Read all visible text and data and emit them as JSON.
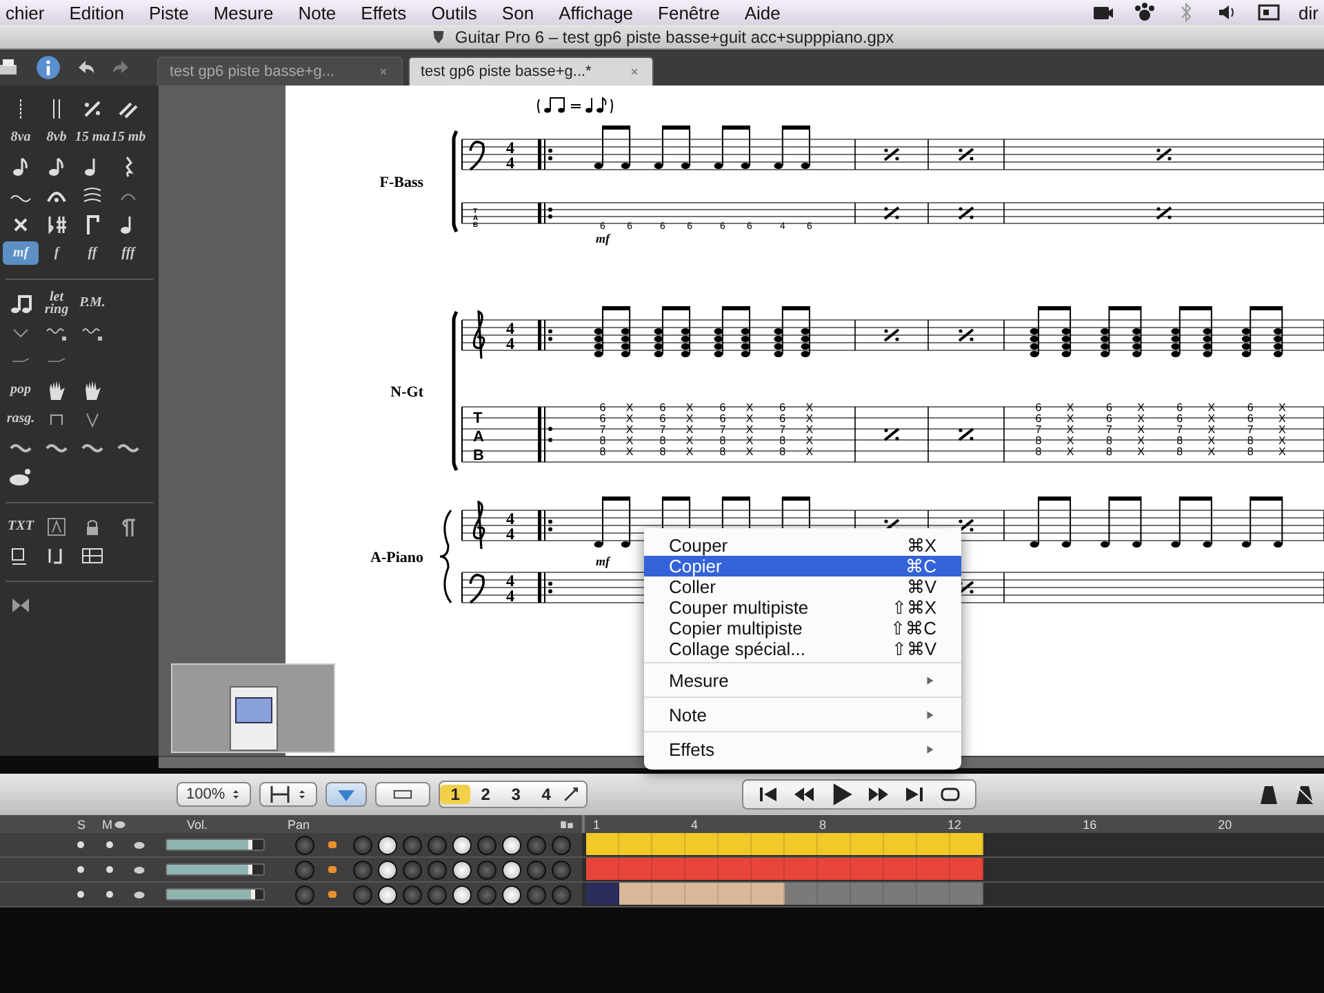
{
  "menu_bar": {
    "items": [
      "chier",
      "Edition",
      "Piste",
      "Mesure",
      "Note",
      "Effets",
      "Outils",
      "Son",
      "Affichage",
      "Fenêtre",
      "Aide"
    ],
    "user": "dir"
  },
  "window": {
    "title": "Guitar Pro 6 – test gp6 piste basse+guit acc+supppiano.gpx"
  },
  "tabs": [
    {
      "label": "test gp6 piste basse+g...",
      "selected": false
    },
    {
      "label": "test gp6 piste basse+g...*",
      "selected": true
    }
  ],
  "palette": {
    "items": [
      {
        "text": "8va",
        "selected": false
      },
      {
        "text": "8vb",
        "selected": false
      },
      {
        "text": "15 ma",
        "selected": false
      },
      {
        "text": "15 mb",
        "selected": false
      },
      {
        "text": "mf",
        "selected": true
      },
      {
        "text": "f",
        "selected": false
      },
      {
        "text": "ff",
        "selected": false
      },
      {
        "text": "fff",
        "selected": false
      },
      {
        "text": "let ring",
        "selected": false
      },
      {
        "text": "P.M.",
        "selected": false
      },
      {
        "text": "pop",
        "selected": false
      },
      {
        "text": "rasg.",
        "selected": false
      },
      {
        "text": "TXT",
        "selected": false
      }
    ]
  },
  "score": {
    "tracks": [
      {
        "name": "F-Bass",
        "dynamic": "mf",
        "staves": [
          {
            "kind": "bass",
            "time_signature": [
              "4",
              "4"
            ]
          },
          {
            "kind": "tab",
            "tab_letters": [
              "T",
              "A",
              "B"
            ],
            "numbers": [
              "6",
              "6",
              "6",
              "6",
              "6",
              "6",
              "4",
              "6"
            ]
          }
        ],
        "measures": [
          {
            "kind": "notes"
          },
          {
            "kind": "repeat"
          },
          {
            "kind": "repeat"
          },
          {
            "kind": "repeat"
          }
        ]
      },
      {
        "name": "N-Gt",
        "staves": [
          {
            "kind": "treble",
            "time_signature": [
              "4",
              "4"
            ]
          },
          {
            "kind": "tab",
            "tab_letters": [
              "T",
              "A",
              "B"
            ],
            "measure_columns": [
              [
                [
                  "6",
                  "6",
                  "7",
                  "8",
                  "8"
                ],
                [
                  "X",
                  "X",
                  "X",
                  "X",
                  "X"
                ],
                [
                  "6",
                  "6",
                  "7",
                  "8",
                  "8"
                ],
                [
                  "X",
                  "X",
                  "X",
                  "X",
                  "X"
                ],
                [
                  "6",
                  "6",
                  "7",
                  "8",
                  "8"
                ],
                [
                  "X",
                  "X",
                  "X",
                  "X",
                  "X"
                ],
                [
                  "6",
                  "6",
                  "7",
                  "8",
                  "8"
                ],
                [
                  "X",
                  "X",
                  "X",
                  "X",
                  "X"
                ]
              ],
              [
                [
                  "6",
                  "6",
                  "7",
                  "8",
                  "8"
                ],
                [
                  "X",
                  "X",
                  "X",
                  "X",
                  "X"
                ],
                [
                  "6",
                  "6",
                  "7",
                  "8",
                  "8"
                ],
                [
                  "X",
                  "X",
                  "X",
                  "X",
                  "X"
                ],
                [
                  "6",
                  "6",
                  "7",
                  "8",
                  "8"
                ],
                [
                  "X",
                  "X",
                  "X",
                  "X",
                  "X"
                ],
                [
                  "6",
                  "6",
                  "7",
                  "8",
                  "8"
                ],
                [
                  "X",
                  "X",
                  "X",
                  "X",
                  "X"
                ]
              ]
            ]
          }
        ],
        "measures": [
          {
            "kind": "chords"
          },
          {
            "kind": "repeat"
          },
          {
            "kind": "repeat"
          },
          {
            "kind": "chords"
          }
        ]
      },
      {
        "name": "A-Piano",
        "dynamic": "mf",
        "staves": [
          {
            "kind": "treble",
            "time_signature": [
              "4",
              "4"
            ]
          },
          {
            "kind": "bass",
            "time_signature": [
              "4",
              "4"
            ],
            "measures": [
              {
                "kind": "empty"
              },
              {
                "kind": "covered"
              },
              {
                "kind": "repeat"
              },
              {
                "kind": "empty"
              }
            ]
          }
        ],
        "measures": [
          {
            "kind": "notes"
          },
          {
            "kind": "repeat"
          },
          {
            "kind": "repeat"
          },
          {
            "kind": "notes"
          }
        ]
      }
    ]
  },
  "context_menu": {
    "groups": [
      [
        {
          "label": "Couper",
          "shortcut": "⌘X",
          "selected": false
        },
        {
          "label": "Copier",
          "shortcut": "⌘C",
          "selected": true
        },
        {
          "label": "Coller",
          "shortcut": "⌘V",
          "selected": false
        },
        {
          "label": "Couper multipiste",
          "shortcut": "⇧⌘X",
          "selected": false
        },
        {
          "label": "Copier multipiste",
          "shortcut": "⇧⌘C",
          "selected": false
        },
        {
          "label": "Collage spécial...",
          "shortcut": "⇧⌘V",
          "selected": false
        }
      ],
      [
        {
          "label": "Mesure",
          "submenu": true,
          "selected": false
        }
      ],
      [
        {
          "label": "Note",
          "submenu": true,
          "selected": false
        }
      ],
      [
        {
          "label": "Effets",
          "submenu": true,
          "selected": false
        }
      ]
    ]
  },
  "bottom_toolbar": {
    "zoom": "100%",
    "view_toggle": {
      "on": true
    },
    "multitrack_toggle": {
      "on": false
    },
    "pages": [
      {
        "label": "1",
        "selected": true
      },
      {
        "label": "2",
        "selected": false
      },
      {
        "label": "3",
        "selected": false
      },
      {
        "label": "4",
        "selected": false
      }
    ]
  },
  "mixer": {
    "headers": {
      "solo": "S",
      "mute": "M",
      "volume": "Vol.",
      "pan": "Pan"
    },
    "ruler": [
      "1",
      "4",
      "8",
      "12",
      "16",
      "20"
    ],
    "tracks": [
      {
        "level": 0.88,
        "blocks": [
          {
            "color": "#f2c928"
          },
          {
            "color": "#f2c928"
          },
          {
            "color": "#f2c928"
          },
          {
            "color": "#f2c928"
          },
          {
            "color": "#f2c928"
          },
          {
            "color": "#f2c928"
          },
          {
            "color": "#f2c928"
          },
          {
            "color": "#f2c928"
          },
          {
            "color": "#f2c928"
          },
          {
            "color": "#f2c928"
          },
          {
            "color": "#f2c928"
          },
          {
            "color": "#f2c928"
          }
        ]
      },
      {
        "level": 0.88,
        "blocks": [
          {
            "color": "#e8453a"
          },
          {
            "color": "#e8453a"
          },
          {
            "color": "#e8453a"
          },
          {
            "color": "#e8453a"
          },
          {
            "color": "#e8453a"
          },
          {
            "color": "#e8453a"
          },
          {
            "color": "#e8453a"
          },
          {
            "color": "#e8453a"
          },
          {
            "color": "#e8453a"
          },
          {
            "color": "#e8453a"
          },
          {
            "color": "#e8453a"
          },
          {
            "color": "#e8453a"
          }
        ]
      },
      {
        "level": 0.92,
        "blocks": [
          {
            "color": "#2b2d5c"
          },
          {
            "color": "#d9b89a"
          },
          {
            "color": "#d9b89a"
          },
          {
            "color": "#d9b89a"
          },
          {
            "color": "#d9b89a"
          },
          {
            "color": "#d9b89a"
          },
          {
            "color": "#7a7a7a"
          },
          {
            "color": "#7a7a7a"
          },
          {
            "color": "#7a7a7a"
          },
          {
            "color": "#7a7a7a"
          },
          {
            "color": "#7a7a7a"
          },
          {
            "color": "#7a7a7a"
          }
        ]
      }
    ]
  }
}
